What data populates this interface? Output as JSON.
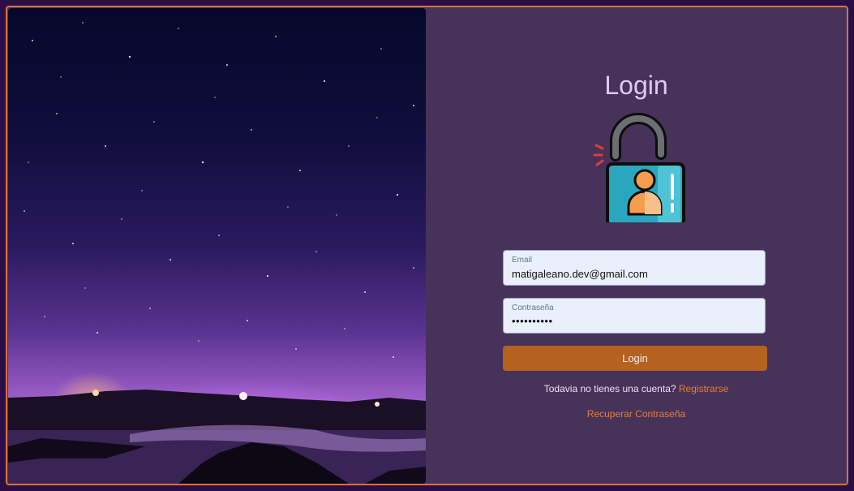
{
  "login": {
    "title": "Login",
    "email_label": "Email",
    "email_value": "matigaleano.dev@gmail.com",
    "password_label": "Contraseña",
    "password_mask": "••••••••••",
    "submit_label": "Login",
    "no_account_text": "Todavia no tienes una cuenta?",
    "register_link": "Registrarse",
    "recover_link": "Recuperar Contraseña"
  },
  "icons": {
    "lock": "unlocked-padlock-user-icon",
    "photo": "starry-night-lake-image"
  },
  "colors": {
    "page_background": "#2a0f46",
    "panel_background": "#47325a",
    "border": "#d9733a",
    "title": "#e3c8f5",
    "button": "#b5611f",
    "link": "#e57e34"
  }
}
